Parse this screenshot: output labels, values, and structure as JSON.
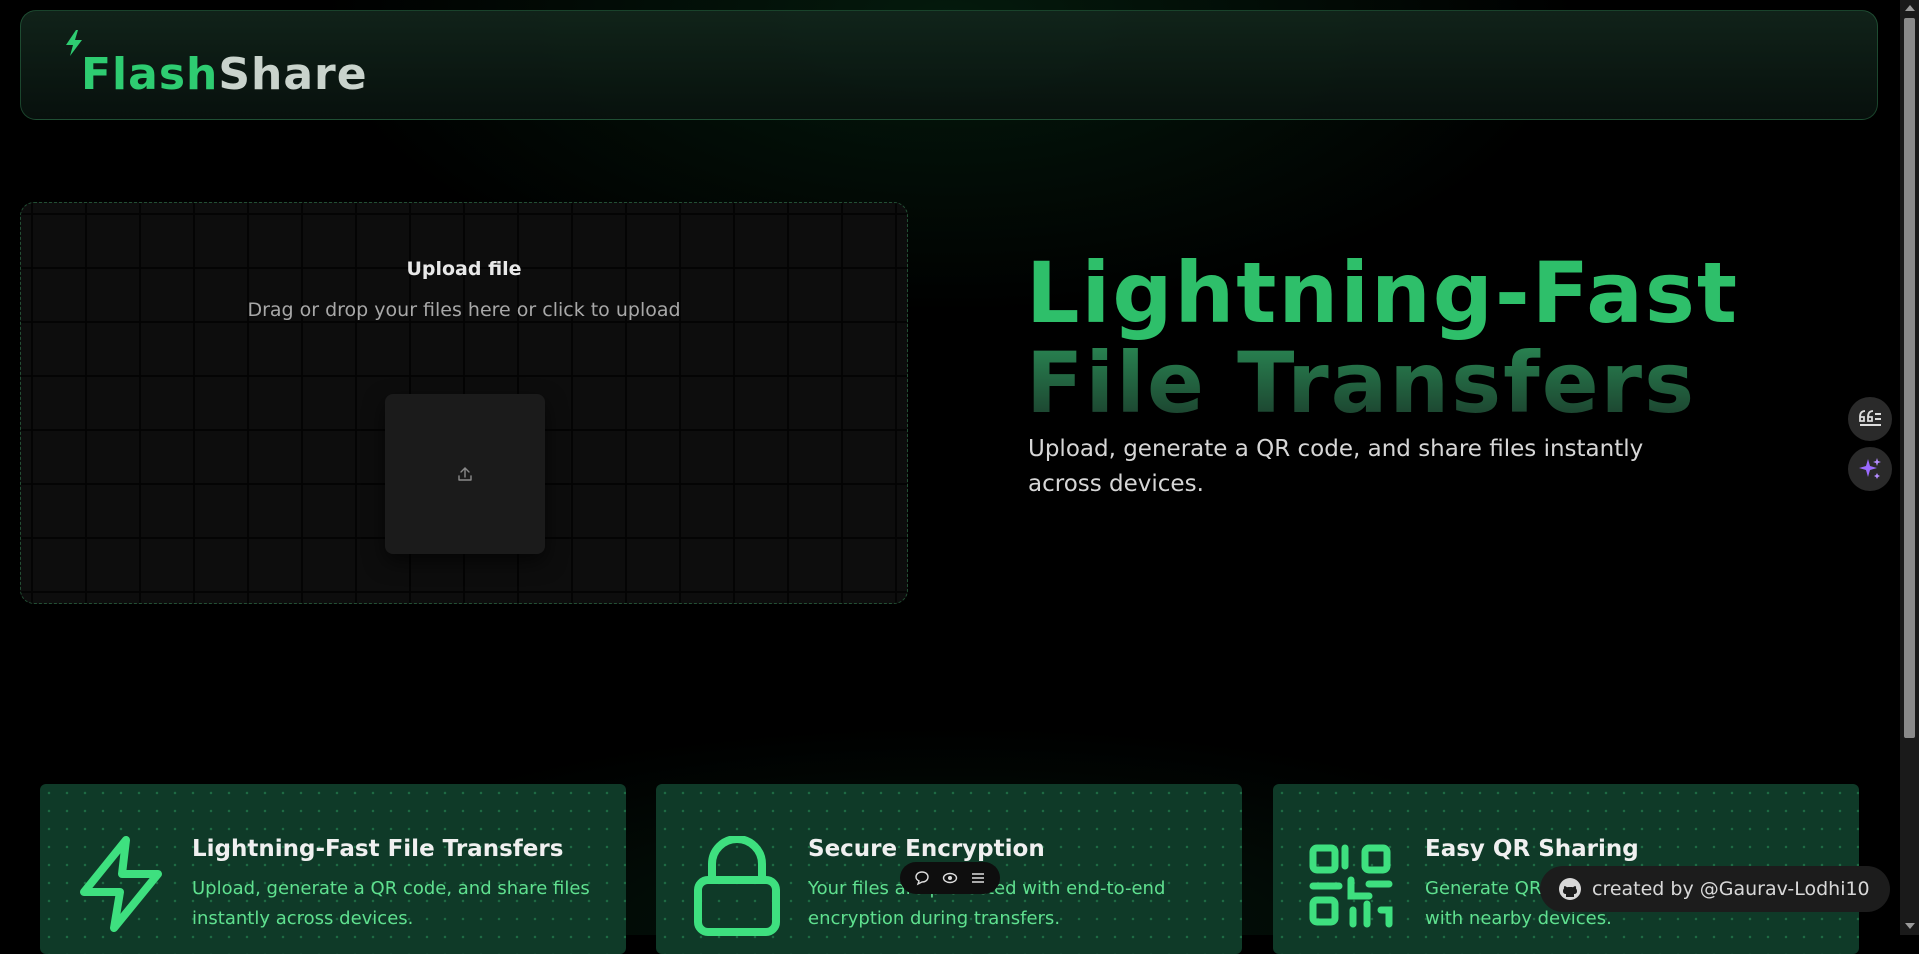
{
  "header": {
    "logo_part1": "Flash",
    "logo_part2": "Share"
  },
  "upload": {
    "title": "Upload file",
    "subtitle": "Drag or drop your files here or click to upload",
    "icon": "upload-icon"
  },
  "hero": {
    "title_line1": "Lightning-Fast",
    "title_line2": "File Transfers",
    "subtitle": "Upload, generate a QR code, and share files instantly across devices."
  },
  "features": [
    {
      "icon": "lightning-icon",
      "title": "Lightning-Fast File Transfers",
      "text": "Upload, generate a QR code, and share files instantly across devices."
    },
    {
      "icon": "lock-icon",
      "title": "Secure Encryption",
      "text": "Your files are protected with end-to-end encryption during transfers."
    },
    {
      "icon": "qr-code-icon",
      "title": "Easy QR Sharing",
      "text": "Generate QR codes to share files effortlessly with nearby devices."
    }
  ],
  "side_widgets": [
    "quote-icon",
    "sparkle-icon"
  ],
  "floating_toolbar": [
    "comment-icon",
    "eye-icon",
    "menu-icon"
  ],
  "credit": {
    "text": "created by @Gaurav-Lodhi10",
    "icon": "github-icon"
  },
  "colors": {
    "accent": "#2ecc71",
    "card_bg": "#0f3a28",
    "card_text": "#5fe08f"
  }
}
